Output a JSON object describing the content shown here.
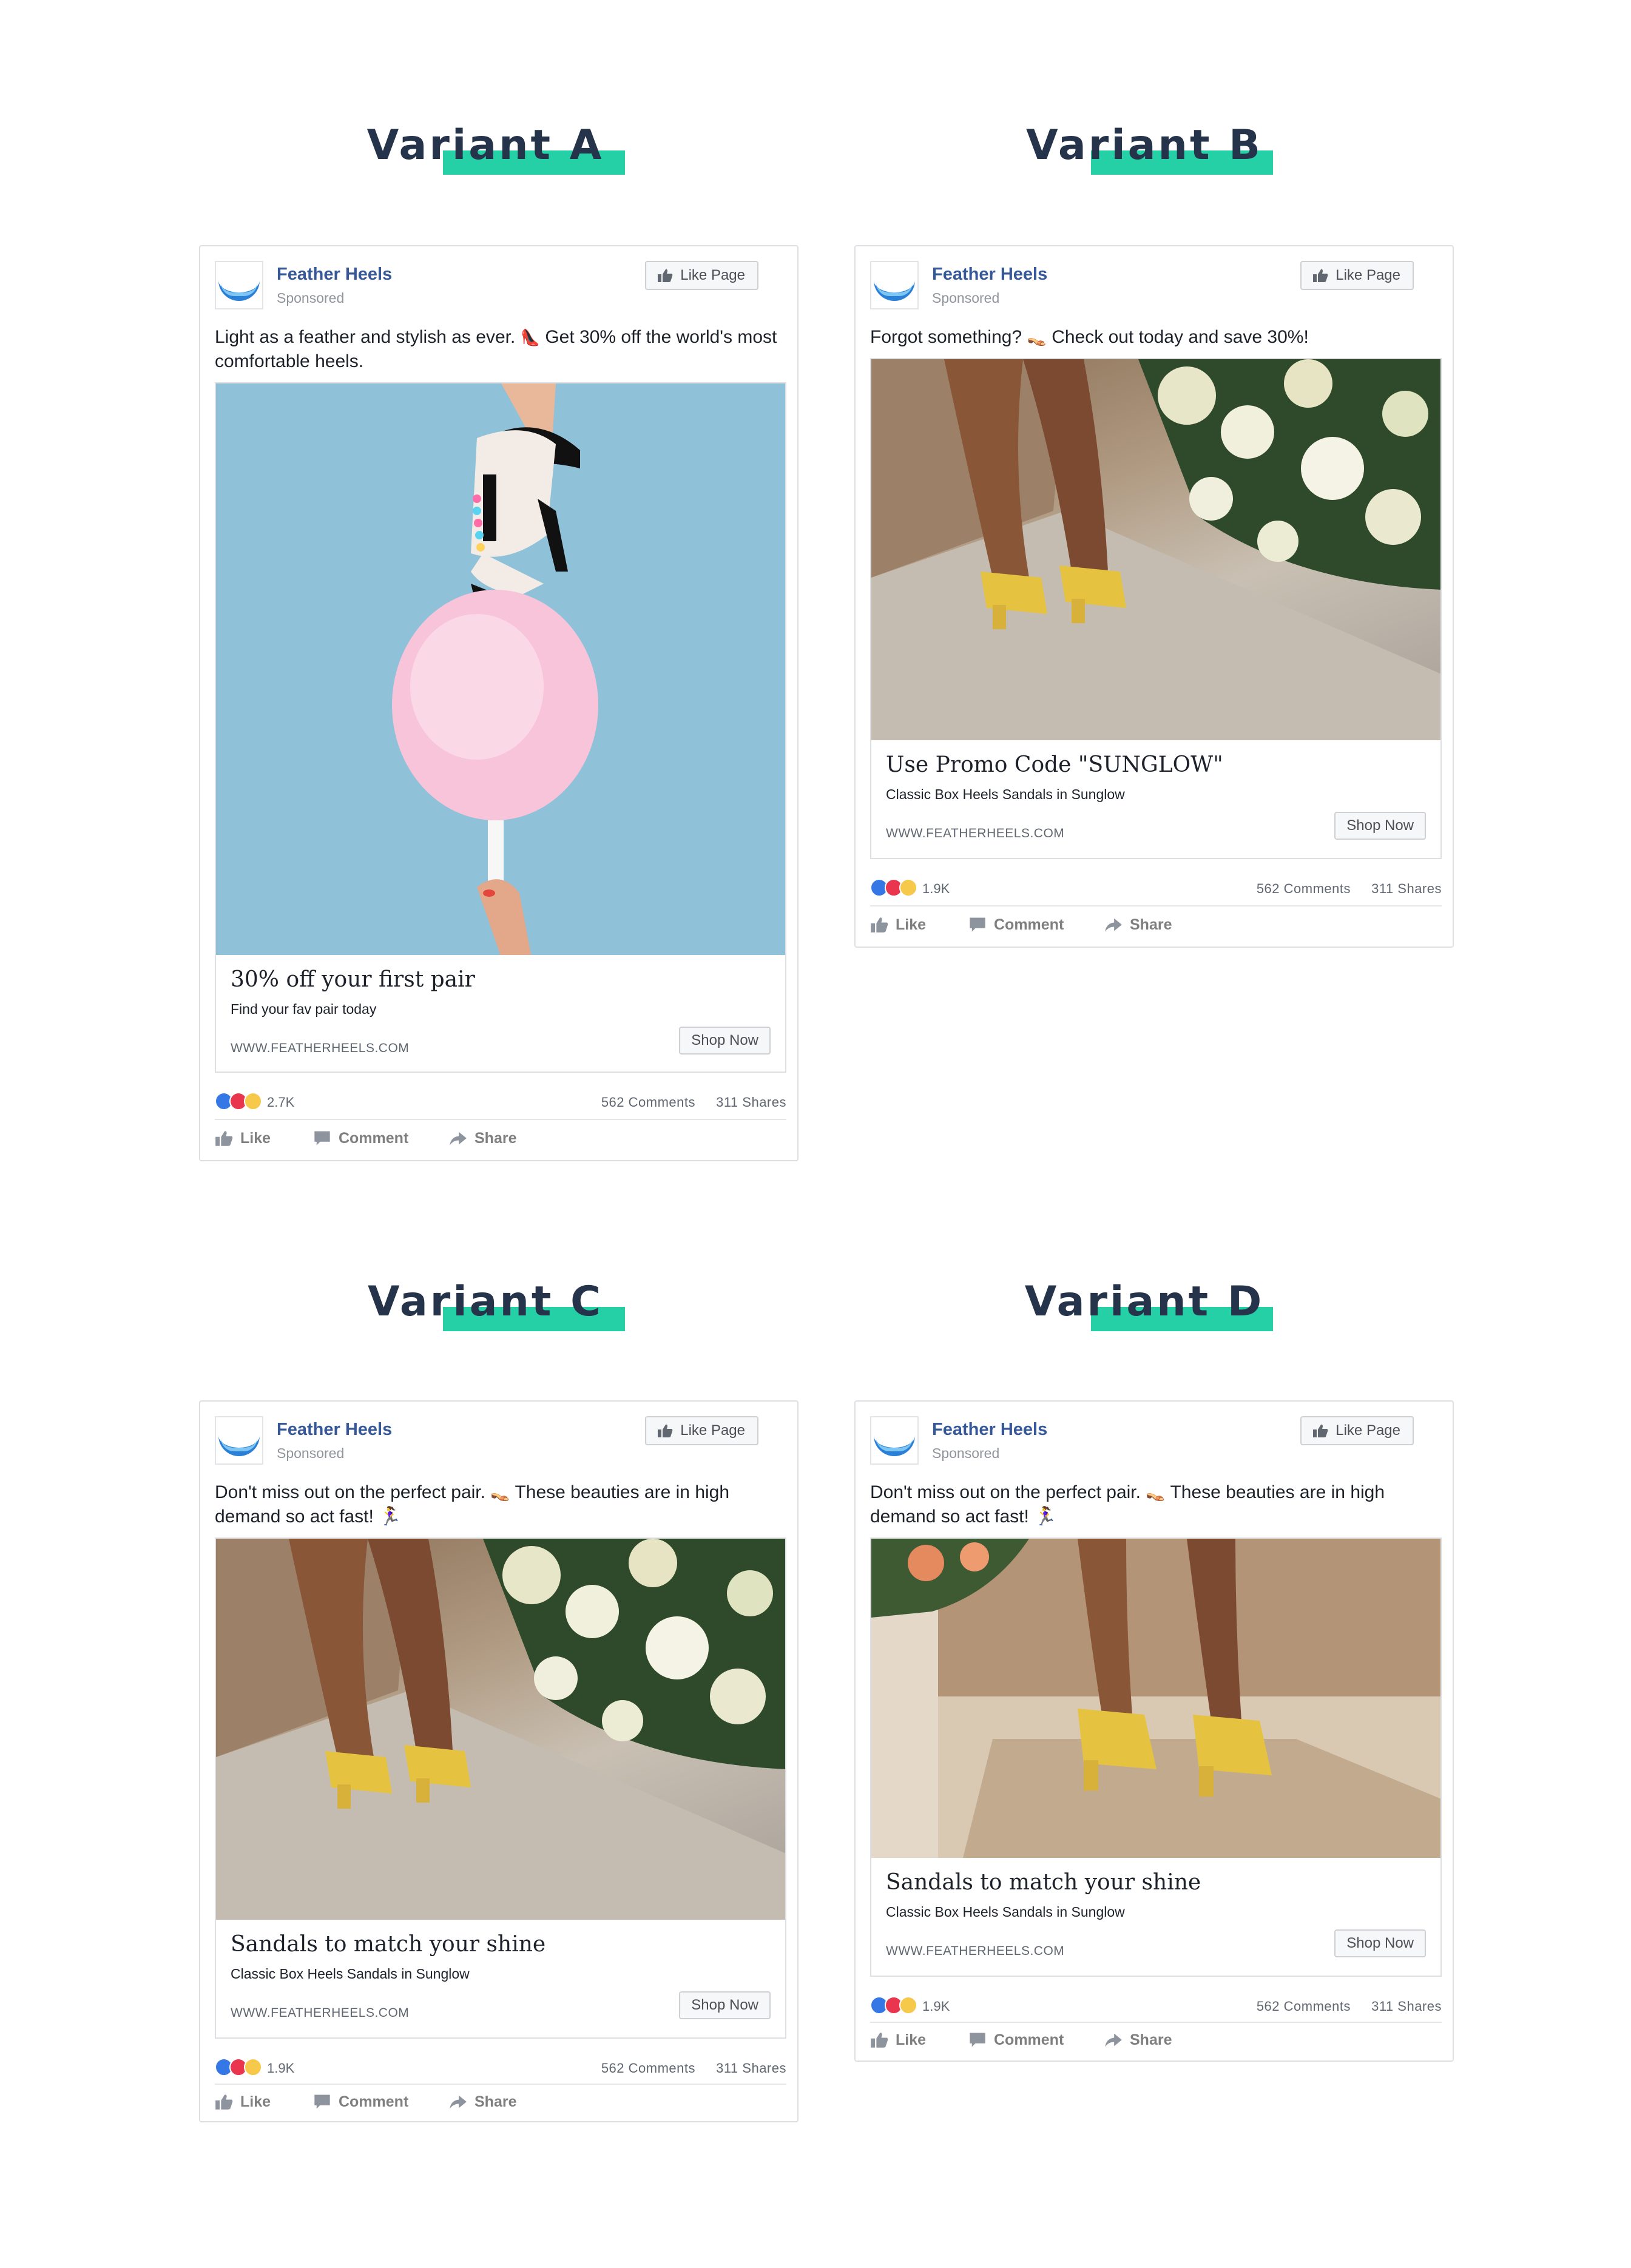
{
  "colors": {
    "accent_highlight": "#25d0a6",
    "title_text": "#25344a",
    "page_name": "#365899",
    "like_blue": "#3578e5",
    "love_red": "#e9364e",
    "wow_yellow": "#f6c94a"
  },
  "variants": [
    {
      "title": "Variant A",
      "page_name": "Feather Heels",
      "sponsored": "Sponsored",
      "like_page": "Like Page",
      "text_line1": "Light as a feather and stylish as ever. ",
      "emoji1": "👠",
      "text_line2": " Get 30% off the world's most comfortable heels.",
      "image_icon": "heel-on-cotton-candy-photo",
      "headline": "30% off your first pair",
      "subline": "Find your fav pair today",
      "domain": "WWW.FEATHERHEELS.COM",
      "cta": "Shop Now",
      "reactions": "2.7K",
      "comments": "562 Comments",
      "shares": "311 Shares",
      "like": "Like",
      "comment": "Comment",
      "share": "Share"
    },
    {
      "title": "Variant B",
      "page_name": "Feather Heels",
      "sponsored": "Sponsored",
      "like_page": "Like Page",
      "text_line1": "Forgot something? ",
      "emoji1": "👡",
      "text_line2": " Check out today and save 30%!",
      "image_icon": "sandals-on-steps-photo",
      "headline": "Use Promo Code \"SUNGLOW\"",
      "subline": "Classic Box Heels Sandals in Sunglow",
      "domain": "WWW.FEATHERHEELS.COM",
      "cta": "Shop Now",
      "reactions": "1.9K",
      "comments": "562 Comments",
      "shares": "311 Shares",
      "like": "Like",
      "comment": "Comment",
      "share": "Share"
    },
    {
      "title": "Variant C",
      "page_name": "Feather Heels",
      "sponsored": "Sponsored",
      "like_page": "Like Page",
      "text_line1": "Don't miss out on the perfect pair. ",
      "emoji1": "👡",
      "text_line2": " These beauties are in high demand so act fast! 🏃‍♀️",
      "image_icon": "sandals-on-steps-photo",
      "headline": "Sandals to match your shine",
      "subline": "Classic Box Heels Sandals in Sunglow",
      "domain": "WWW.FEATHERHEELS.COM",
      "cta": "Shop Now",
      "reactions": "1.9K",
      "comments": "562 Comments",
      "shares": "311 Shares",
      "like": "Like",
      "comment": "Comment",
      "share": "Share"
    },
    {
      "title": "Variant D",
      "page_name": "Feather Heels",
      "sponsored": "Sponsored",
      "like_page": "Like Page",
      "text_line1": "Don't miss out on the perfect pair. ",
      "emoji1": "👡",
      "text_line2": " These beauties are in high demand so act fast! 🏃‍♀️",
      "image_icon": "sandals-standing-photo",
      "headline": "Sandals to match your shine",
      "subline": "Classic Box Heels Sandals in Sunglow",
      "domain": "WWW.FEATHERHEELS.COM",
      "cta": "Shop Now",
      "reactions": "1.9K",
      "comments": "562 Comments",
      "shares": "311 Shares",
      "like": "Like",
      "comment": "Comment",
      "share": "Share"
    }
  ]
}
